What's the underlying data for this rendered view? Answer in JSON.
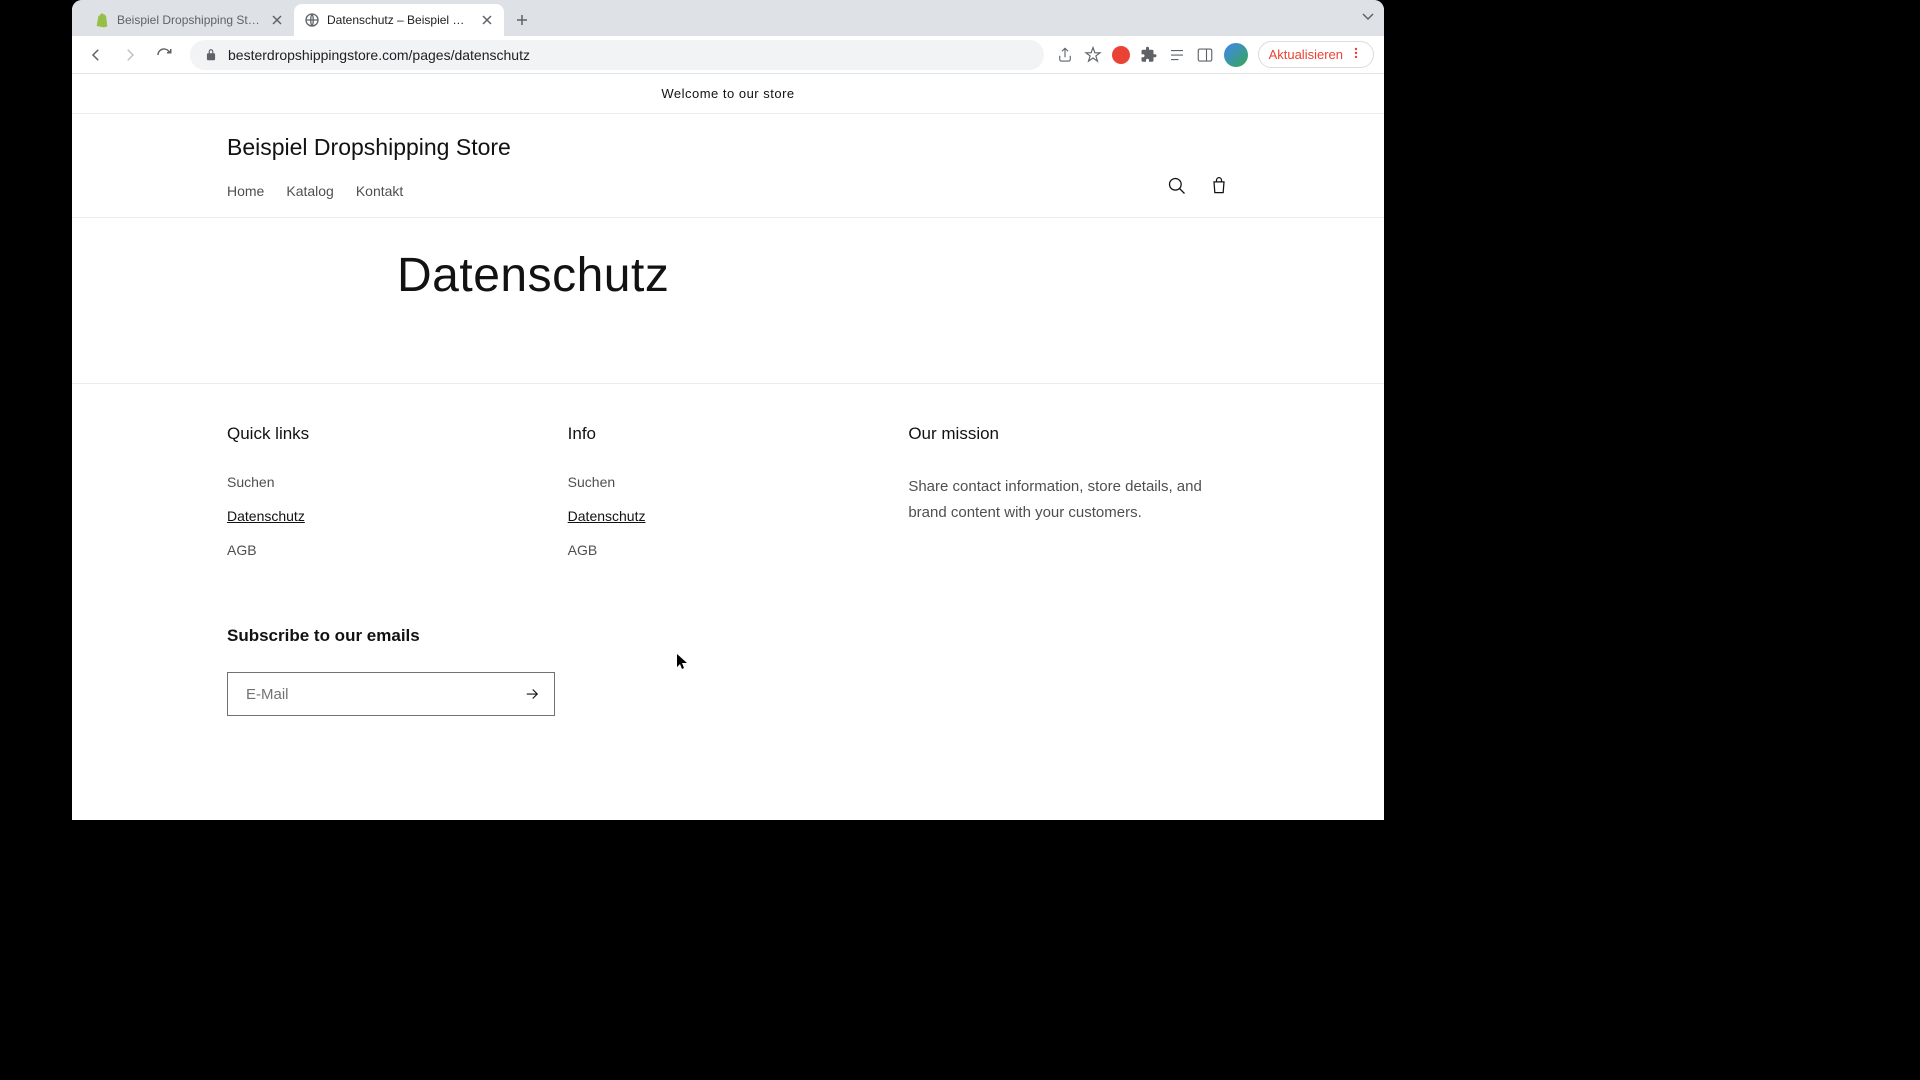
{
  "browser": {
    "tabs": [
      {
        "title": "Beispiel Dropshipping Store · F",
        "active": false
      },
      {
        "title": "Datenschutz – Beispiel Dropsh",
        "active": true
      }
    ],
    "url": "besterdropshippingstore.com/pages/datenschutz",
    "update_button": "Aktualisieren"
  },
  "store": {
    "announcement": "Welcome to our store",
    "logo": "Beispiel Dropshipping Store",
    "nav": [
      "Home",
      "Katalog",
      "Kontakt"
    ]
  },
  "page": {
    "title": "Datenschutz"
  },
  "footer": {
    "columns": [
      {
        "heading": "Quick links",
        "links": [
          {
            "label": "Suchen",
            "active": false
          },
          {
            "label": "Datenschutz",
            "active": true
          },
          {
            "label": "AGB",
            "active": false
          }
        ]
      },
      {
        "heading": "Info",
        "links": [
          {
            "label": "Suchen",
            "active": false
          },
          {
            "label": "Datenschutz",
            "active": true
          },
          {
            "label": "AGB",
            "active": false
          }
        ]
      },
      {
        "heading": "Our mission",
        "text": "Share contact information, store details, and brand content with your customers."
      }
    ],
    "subscribe": {
      "heading": "Subscribe to our emails",
      "placeholder": "E-Mail"
    }
  }
}
